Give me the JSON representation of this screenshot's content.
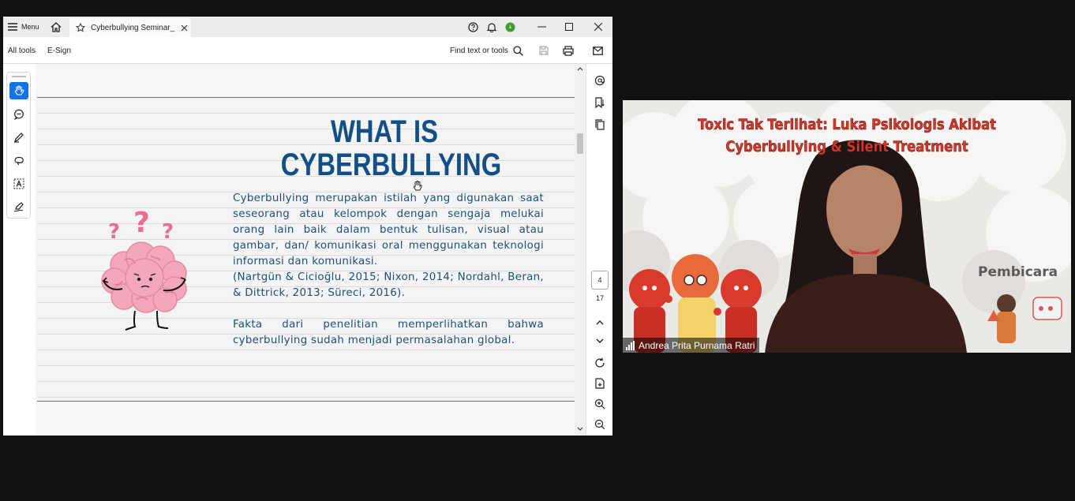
{
  "acrobat": {
    "menu_label": "Menu",
    "tab_title": "Cyberbullying Seminar_",
    "toolbar": {
      "all_tools": "All tools",
      "esign": "E-Sign",
      "find_placeholder": "Find text or tools"
    },
    "slide": {
      "title_line1": "WHAT IS",
      "title_line2": "CYBERBULLYING",
      "paragraph1": "Cyberbullying merupakan istilah yang digunakan saat seseorang atau kelompok dengan sengaja melukai orang lain baik dalam bentuk tulisan, visual atau gambar, dan/ komunikasi oral menggunakan teknologi informasi dan komunikasi.",
      "citation": "(Nartgün & Cicioğlu, 2015; Nixon, 2014; Nordahl, Beran, & Dittrick, 2013; Süreci, 2016).",
      "paragraph2": "Fakta dari penelitian memperlihatkan bahwa cyberbullying sudah menjadi permasalahan global."
    },
    "page": {
      "current": "4",
      "total": "17"
    }
  },
  "video": {
    "banner_line1": "Toxic Tak Terlihat: Luka Psikologis Akibat",
    "banner_line2": "Cyberbullying & Silent Treatment",
    "speaker_label": "Pembicara",
    "participant_name": "Andrea Prita Purnama Ratri"
  },
  "colors": {
    "slide_title": "#134f87",
    "slide_text": "#1d4f7f",
    "banner_text": "#d8362a",
    "active_tool": "#1473e6"
  }
}
